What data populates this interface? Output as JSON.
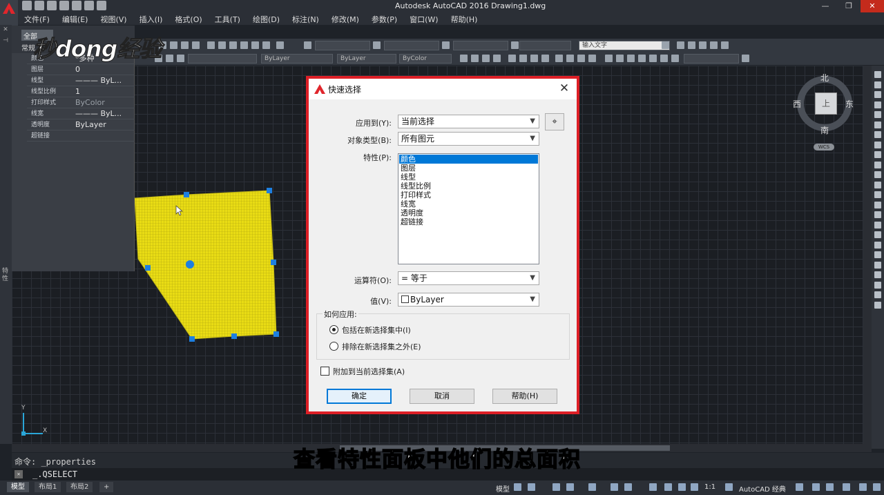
{
  "window": {
    "title": "Autodesk AutoCAD 2016    Drawing1.dwg",
    "minimize": "—",
    "restore": "❐",
    "close": "✕"
  },
  "menu": [
    "文件(F)",
    "编辑(E)",
    "视图(V)",
    "插入(I)",
    "格式(O)",
    "工具(T)",
    "绘图(D)",
    "标注(N)",
    "修改(M)",
    "参数(P)",
    "窗口(W)",
    "帮助(H)"
  ],
  "toolbar": {
    "search_placeholder": "输入文字",
    "layer_combo": "",
    "linetype_combo": "ByLayer",
    "lineweight_combo": "ByLayer",
    "color_combo": "ByColor"
  },
  "properties_panel": {
    "selector_label": "全部",
    "section_label": "常规",
    "rows": [
      {
        "name": "颜色",
        "value": "*多种",
        "dim": false
      },
      {
        "name": "图层",
        "value": "0",
        "dim": false
      },
      {
        "name": "线型",
        "value": "——— ByL...",
        "dim": false
      },
      {
        "name": "线型比例",
        "value": "1",
        "dim": false
      },
      {
        "name": "打印样式",
        "value": "ByColor",
        "dim": true
      },
      {
        "name": "线宽",
        "value": "——— ByL...",
        "dim": false
      },
      {
        "name": "透明度",
        "value": "ByLayer",
        "dim": false
      },
      {
        "name": "超链接",
        "value": "",
        "dim": false
      }
    ],
    "strip_label": "特性"
  },
  "watermark": "秒dong经验",
  "viewcube": {
    "north": "北",
    "south": "南",
    "east": "东",
    "west": "西",
    "top": "上",
    "wcs": "WCS"
  },
  "ucs": {
    "x": "X",
    "y": "Y"
  },
  "command": {
    "history": "命令: _properties",
    "input": "_.QSELECT",
    "close_glyph": "✕"
  },
  "status": {
    "tabs": [
      "模型",
      "布局1",
      "布局2"
    ],
    "add_tab": "+",
    "model_label": "模型",
    "scale": "1:1",
    "workspace": "AutoCAD 经典"
  },
  "subtitle": "查看特性面板中他们的总面积",
  "dialog": {
    "title": "快速选择",
    "close": "✕",
    "apply_to_label": "应用到(Y):",
    "apply_to_value": "当前选择",
    "object_type_label": "对象类型(B):",
    "object_type_value": "所有图元",
    "properties_label": "特性(P):",
    "properties": [
      "颜色",
      "图层",
      "线型",
      "线型比例",
      "打印样式",
      "线宽",
      "透明度",
      "超链接"
    ],
    "selected_property": 0,
    "operator_label": "运算符(O):",
    "operator_value": "= 等于",
    "value_label": "值(V):",
    "value_value": "ByLayer",
    "how_to_apply_label": "如何应用:",
    "include_label": "包括在新选择集中(I)",
    "exclude_label": "排除在新选择集之外(E)",
    "append_label": "附加到当前选择集(A)",
    "ok": "确定",
    "cancel": "取消",
    "help": "帮助(H)",
    "pick_glyph": "⌖",
    "dropdown_glyph": "▼"
  },
  "colors": {
    "selection_fill": "#e9dc14",
    "grip": "#1d7fe0",
    "dialog_highlight_frame": "#dd1f26",
    "list_selection": "#0078d7"
  }
}
